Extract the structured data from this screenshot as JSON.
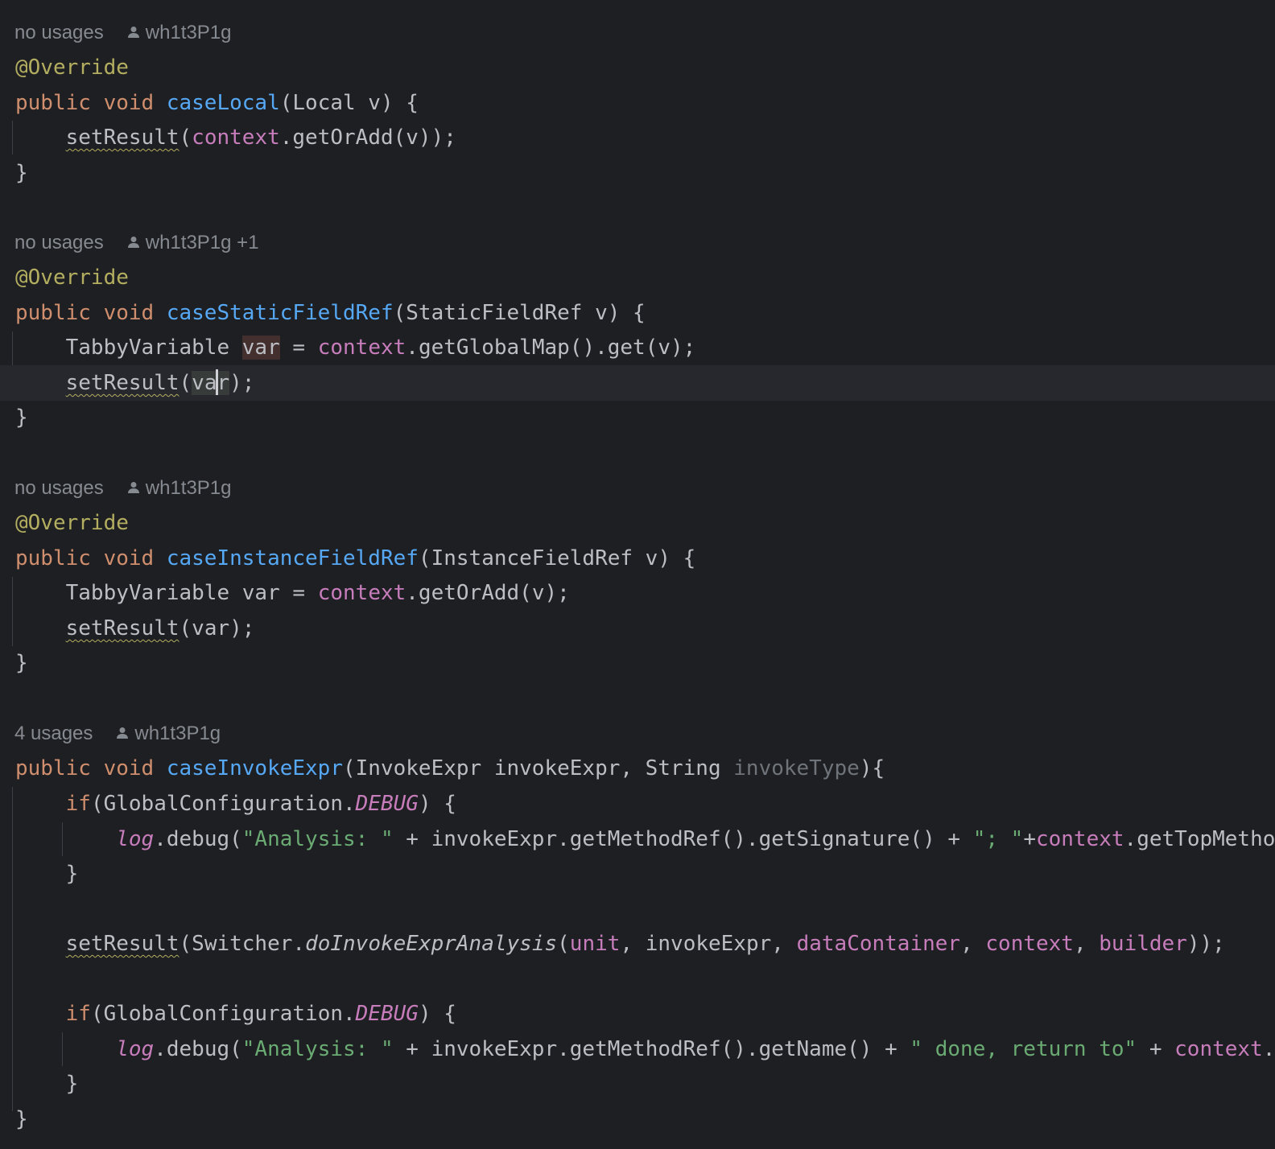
{
  "colors": {
    "background": "#1e1f22",
    "current_line": "#26282e",
    "keyword": "#cf8e6d",
    "annotation": "#b3ae60",
    "method_declaration": "#56a8f5",
    "field": "#c77dbb",
    "string": "#6aab73",
    "default_text": "#bcbec4",
    "inlay_hint": "#868a91"
  },
  "hints": [
    {
      "usages": "no usages",
      "author": "wh1t3P1g"
    },
    {
      "usages": "no usages",
      "author": "wh1t3P1g +1"
    },
    {
      "usages": "no usages",
      "author": "wh1t3P1g"
    },
    {
      "usages": "4 usages",
      "author": "wh1t3P1g"
    }
  ],
  "code": {
    "l1": "@Override",
    "l2": {
      "kw": "public void ",
      "name": "caseLocal",
      "rest": "(Local v) {"
    },
    "l3": {
      "call": "setResult",
      "open": "(",
      "field": "context",
      "rest": ".getOrAdd(v));"
    },
    "l5": "@Override",
    "l6": {
      "kw": "public void ",
      "name": "caseStaticFieldRef",
      "rest": "(StaticFieldRef v) {"
    },
    "l7": {
      "type": "TabbyVariable ",
      "var": "var",
      "eq": " = ",
      "field": "context",
      "rest": ".getGlobalMap().get(v);"
    },
    "l8": {
      "call": "setResult",
      "open": "(",
      "var_a": "va",
      "var_b": "r",
      "rest": ");"
    },
    "l10": "@Override",
    "l11": {
      "kw": "public void ",
      "name": "caseInstanceFieldRef",
      "rest": "(InstanceFieldRef v) {"
    },
    "l12": {
      "type": "TabbyVariable var = ",
      "field": "context",
      "rest": ".getOrAdd(v);"
    },
    "l13": {
      "call": "setResult",
      "rest": "(var);"
    },
    "l15": {
      "kw": "public void ",
      "name": "caseInvokeExpr",
      "params": "(InvokeExpr invokeExpr, String ",
      "unused": "invokeType",
      "rest": "){"
    },
    "l16": {
      "kw": "if",
      "pre": "(GlobalConfiguration.",
      "const": "DEBUG",
      "rest": ") {"
    },
    "l17": {
      "log": "log",
      "a": ".debug(",
      "s1": "\"Analysis: \"",
      "b": " + invokeExpr.getMethodRef().getSignature() + ",
      "s2": "\"; \"",
      "c": "+",
      "field": "context",
      "d": ".getTopMethod"
    },
    "l18": "}",
    "l20": {
      "call": "setResult",
      "a": "(Switcher.",
      "static_call": "doInvokeExprAnalysis",
      "b": "(",
      "f1": "unit",
      "c": ", invokeExpr, ",
      "f2": "dataContainer",
      "d": ", ",
      "f3": "context",
      "e": ", ",
      "f4": "builder",
      "end": "));"
    },
    "l22": {
      "kw": "if",
      "pre": "(GlobalConfiguration.",
      "const": "DEBUG",
      "rest": ") {"
    },
    "l23": {
      "log": "log",
      "a": ".debug(",
      "s1": "\"Analysis: \"",
      "b": " + invokeExpr.getMethodRef().getName() + ",
      "s2": "\" done, return to\"",
      "c": " + ",
      "field": "context",
      "d": ".g"
    },
    "l24": "}",
    "brace": "}"
  }
}
